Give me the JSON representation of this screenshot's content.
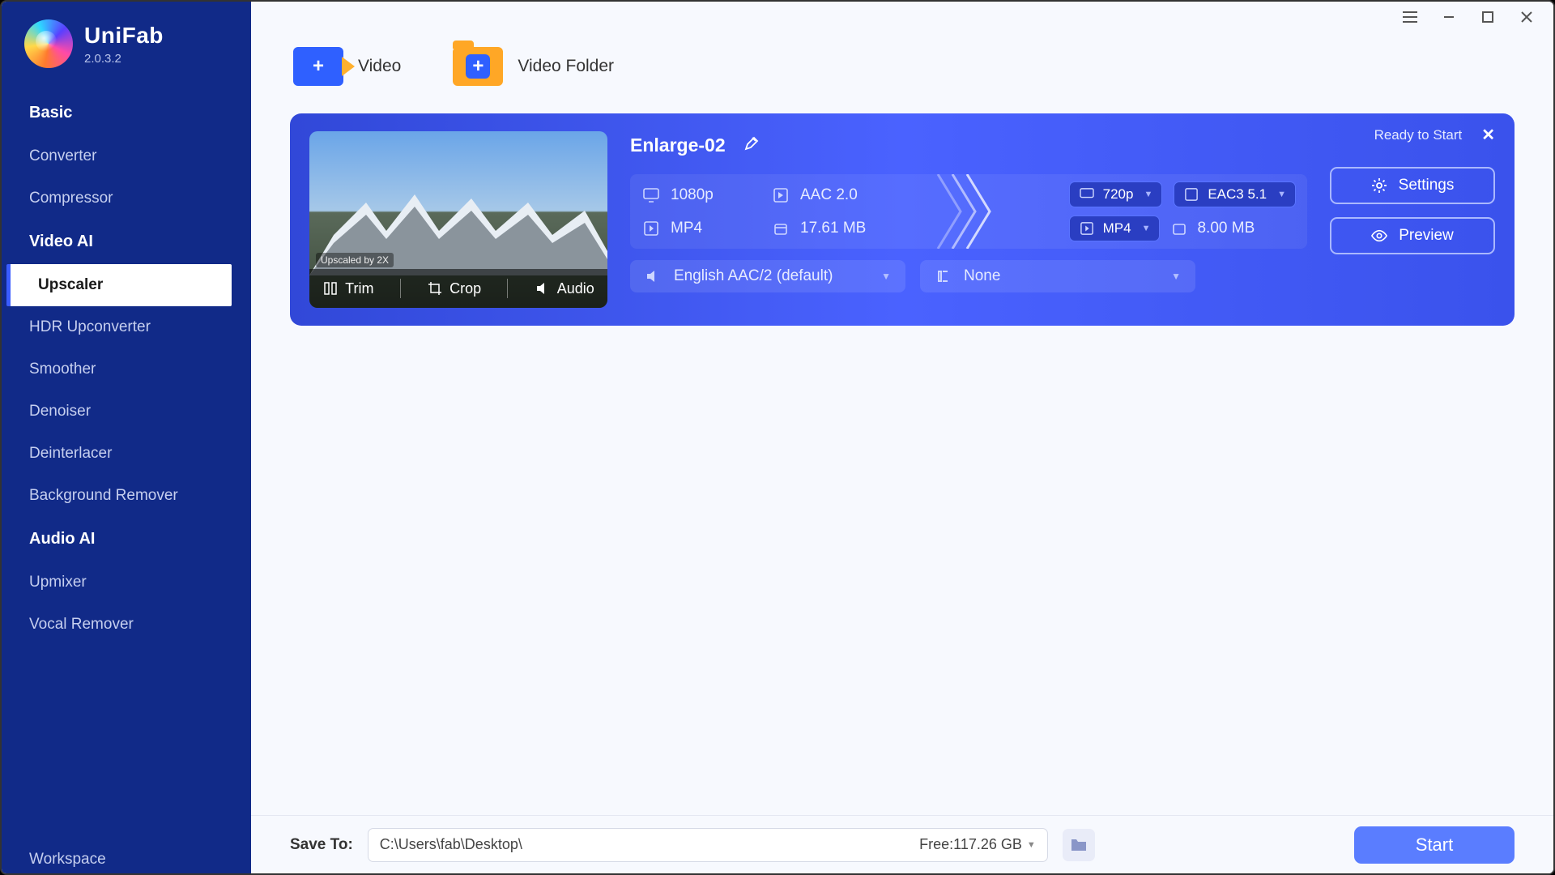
{
  "app": {
    "name": "UniFab",
    "version": "2.0.3.2"
  },
  "sidebar": {
    "sections": [
      {
        "title": "Basic",
        "items": [
          "Converter",
          "Compressor"
        ]
      },
      {
        "title": "Video AI",
        "items": [
          "Upscaler",
          "HDR Upconverter",
          "Smoother",
          "Denoiser",
          "Deinterlacer",
          "Background Remover"
        ],
        "active": "Upscaler"
      },
      {
        "title": "Audio AI",
        "items": [
          "Upmixer",
          "Vocal Remover"
        ]
      }
    ],
    "footer_item": "Workspace"
  },
  "top_actions": {
    "video": "Video",
    "folder": "Video Folder"
  },
  "card": {
    "status": "Ready to Start",
    "title": "Enlarge-02",
    "thumb": {
      "trim": "Trim",
      "crop": "Crop",
      "audio": "Audio",
      "tag": "Upscaled by 2X"
    },
    "input": {
      "resolution": "1080p",
      "audio": "AAC 2.0",
      "container": "MP4",
      "size": "17.61 MB"
    },
    "output": {
      "resolution": "720p",
      "audio": "EAC3 5.1",
      "container": "MP4",
      "size": "8.00 MB"
    },
    "audio_select": "English AAC/2 (default)",
    "subtitle_select": "None",
    "settings_btn": "Settings",
    "preview_btn": "Preview"
  },
  "footer": {
    "save_label": "Save To:",
    "path": "C:\\Users\\fab\\Desktop\\",
    "free": "Free:117.26 GB",
    "start": "Start"
  }
}
